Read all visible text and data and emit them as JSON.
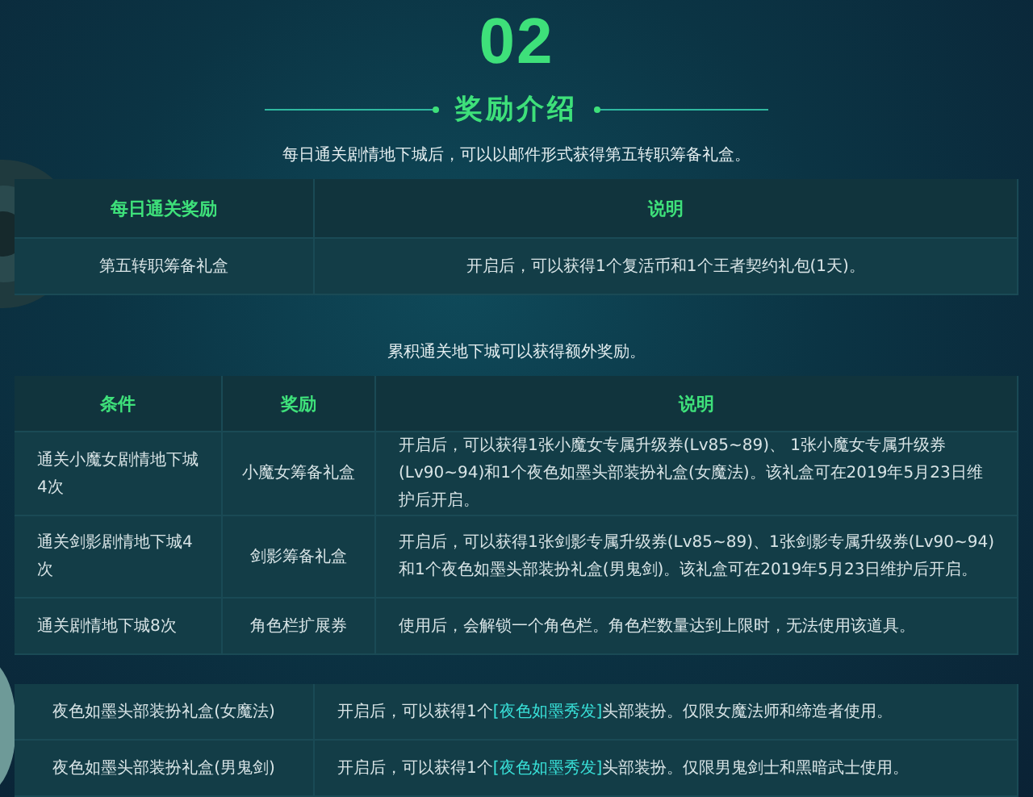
{
  "section": {
    "number": "02",
    "title": "奖励介绍",
    "intro": "每日通关剧情地下城后，可以以邮件形式获得第五转职筹备礼盒。"
  },
  "daily_table": {
    "columns": [
      "每日通关奖励",
      "说明"
    ],
    "rows": [
      [
        "第五转职筹备礼盒",
        "开启后，可以获得1个复活币和1个王者契约礼包(1天)。"
      ]
    ]
  },
  "cumulative_intro": "累积通关地下城可以获得额外奖励。",
  "cumulative_table": {
    "columns": [
      "条件",
      "奖励",
      "说明"
    ],
    "rows": [
      [
        "通关小魔女剧情地下城4次",
        "小魔女筹备礼盒",
        "开启后，可以获得1张小魔女专属升级券(Lv85~89)、 1张小魔女专属升级券(Lv90~94)和1个夜色如墨头部装扮礼盒(女魔法)。该礼盒可在2019年5月23日维护后开启。"
      ],
      [
        "通关剑影剧情地下城4次",
        "剑影筹备礼盒",
        "开启后，可以获得1张剑影专属升级券(Lv85~89)、1张剑影专属升级券(Lv90~94)和1个夜色如墨头部装扮礼盒(男鬼剑)。该礼盒可在2019年5月23日维护后开启。"
      ],
      [
        "通关剧情地下城8次",
        "角色栏扩展券",
        "使用后，会解锁一个角色栏。角色栏数量达到上限时，无法使用该道具。"
      ]
    ]
  },
  "box_table": {
    "rows": [
      {
        "name": "夜色如墨头部装扮礼盒(女魔法)",
        "before": "开启后，可以获得1个",
        "highlight": "[夜色如墨秀发]",
        "after": "头部装扮。仅限女魔法师和缔造者使用。"
      },
      {
        "name": "夜色如墨头部装扮礼盒(男鬼剑)",
        "before": "开启后，可以获得1个",
        "highlight": "[夜色如墨秀发]",
        "after": "头部装扮。仅限男鬼剑士和黑暗武士使用。"
      }
    ]
  }
}
